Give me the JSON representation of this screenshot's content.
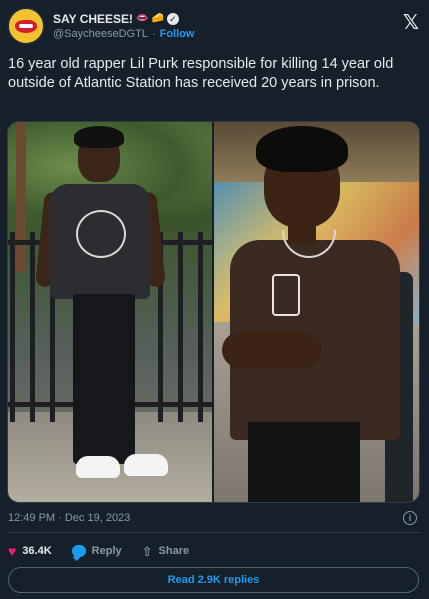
{
  "author": {
    "display_name": "SAY CHEESE!",
    "emojis": [
      "lips-emoji",
      "cheese-emoji"
    ],
    "emoji_glyphs": [
      "👄",
      "🧀"
    ],
    "handle": "@SaycheeseDGTL",
    "separator": "·",
    "follow_label": "Follow",
    "verified": true
  },
  "platform_logo": "𝕏",
  "tweet": {
    "text": "16 year old rapper Lil Purk responsible for killing 14 year old outside of Atlantic Station has received 20 years in prison."
  },
  "media": {
    "photos": [
      "left-photo",
      "right-photo"
    ]
  },
  "meta": {
    "timestamp": "12:49 PM · Dec 19, 2023",
    "info_icon": "i"
  },
  "actions": {
    "likes": "36.4K",
    "reply_label": "Reply",
    "share_label": "Share",
    "heart_glyph": "♥",
    "share_glyph": "⇧"
  },
  "read_replies_label": "Read 2.9K replies",
  "colors": {
    "background": "#15202b",
    "text": "#e7e9ea",
    "muted": "#8b98a5",
    "accent": "#1d9bf0",
    "heart": "#f91880"
  }
}
